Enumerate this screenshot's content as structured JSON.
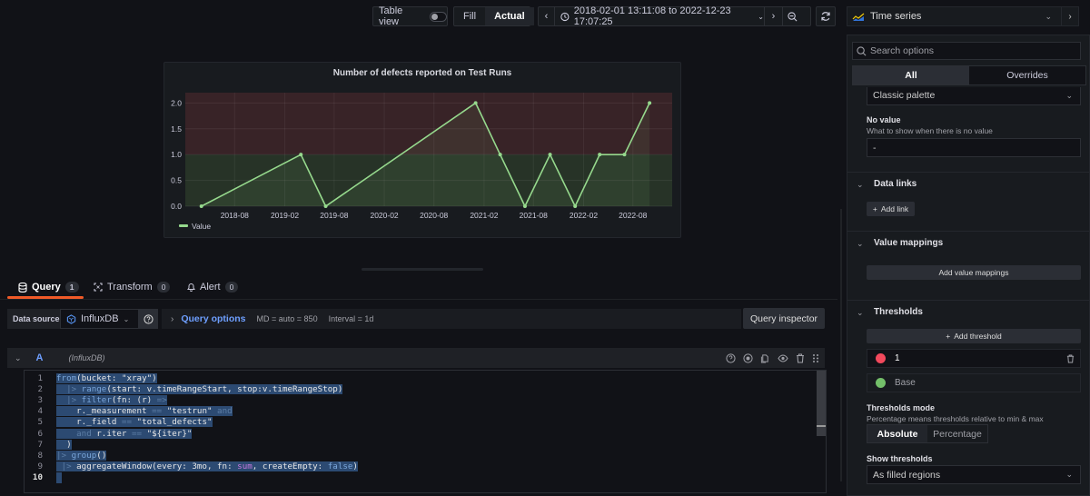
{
  "toolbar": {
    "table_view_label": "Table view",
    "table_view_on": false,
    "fill_label": "Fill",
    "actual_label": "Actual",
    "active_mode": "Actual",
    "time_range": "2018-02-01 13:11:08 to 2022-12-23 17:07:25",
    "icons": [
      "chevron-left-icon",
      "clock-icon",
      "chevron-down-icon",
      "chevron-right-icon",
      "zoom-out-icon",
      "refresh-icon"
    ]
  },
  "panel": {
    "title": "Number of defects reported on Test Runs",
    "legend_label": "Value"
  },
  "chart_data": {
    "type": "line",
    "title": "Number of defects reported on Test Runs",
    "xlabel": "",
    "ylabel": "",
    "x": [
      "2018-04",
      "2019-04",
      "2019-07",
      "2021-01",
      "2021-04",
      "2021-07",
      "2021-10",
      "2022-01",
      "2022-04",
      "2022-07",
      "2022-10"
    ],
    "series": [
      {
        "name": "Value",
        "values": [
          0,
          1,
          0,
          2,
          1,
          0,
          1,
          0,
          1,
          1,
          2
        ],
        "color": "#96d98d"
      }
    ],
    "x_ticks": [
      "2018-08",
      "2019-02",
      "2019-08",
      "2020-02",
      "2020-08",
      "2021-02",
      "2021-08",
      "2022-02",
      "2022-08"
    ],
    "y_ticks": [
      "0.0",
      "0.5",
      "1.0",
      "1.5",
      "2.0"
    ],
    "ylim": [
      0,
      2.2
    ],
    "xlim": [
      "2018-02-01",
      "2022-12-23"
    ],
    "grid": true,
    "legend": "bottom-left",
    "thresholds": [
      {
        "value": "Base",
        "color": "#73bf69"
      },
      {
        "value": 1,
        "color": "#f2495c"
      }
    ],
    "threshold_style": "filled regions"
  },
  "tabs": [
    {
      "label": "Query",
      "count": "1",
      "icon": "database-icon",
      "active": true
    },
    {
      "label": "Transform",
      "count": "0",
      "icon": "transform-icon",
      "active": false
    },
    {
      "label": "Alert",
      "count": "0",
      "icon": "bell-icon",
      "active": false
    }
  ],
  "datasource": {
    "label": "Data source",
    "value": "InfluxDB",
    "query_options_label": "Query options",
    "md": "MD = auto = 850",
    "interval": "Interval = 1d",
    "inspector_label": "Query inspector"
  },
  "query": {
    "ref_id": "A",
    "source": "(InfluxDB)",
    "action_icons": [
      "help-icon",
      "disable-query-icon",
      "duplicate-icon",
      "eye-icon",
      "trash-icon",
      "drag-handle-icon"
    ],
    "lines": [
      "from(bucket: \"xray\")",
      "  |> range(start: v.timeRangeStart, stop:v.timeRangeStop)",
      "  |> filter(fn: (r) =>",
      "    r._measurement == \"testrun\" and",
      "    r._field == \"total_defects\"",
      "    and r.iter == \"${iter}\"",
      "  )",
      "|> group()",
      " |> aggregateWindow(every: 3mo, fn: sum, createEmpty: false)",
      ""
    ],
    "line_numbers": [
      "1",
      "2",
      "3",
      "4",
      "5",
      "6",
      "7",
      "8",
      "9",
      "10"
    ]
  },
  "options": {
    "viz_name": "Time series",
    "search_placeholder": "Search options",
    "tab_all": "All",
    "tab_overrides": "Overrides",
    "color_scheme_value": "Classic palette",
    "no_value_label": "No value",
    "no_value_desc": "What to show when there is no value",
    "no_value_value": "-",
    "data_links_title": "Data links",
    "add_link_label": "Add link",
    "value_mappings_title": "Value mappings",
    "add_value_mappings_label": "Add value mappings",
    "thresholds_title": "Thresholds",
    "add_threshold_label": "Add threshold",
    "thresholds": [
      {
        "value": "1",
        "color": "#f2495c"
      },
      {
        "value": "Base",
        "color": "#73bf69"
      }
    ],
    "thresholds_mode_label": "Thresholds mode",
    "thresholds_mode_desc": "Percentage means thresholds relative to min & max",
    "mode_absolute": "Absolute",
    "mode_percentage": "Percentage",
    "mode_selected": "Absolute",
    "show_thresholds_label": "Show thresholds",
    "show_thresholds_value": "As filled regions"
  }
}
